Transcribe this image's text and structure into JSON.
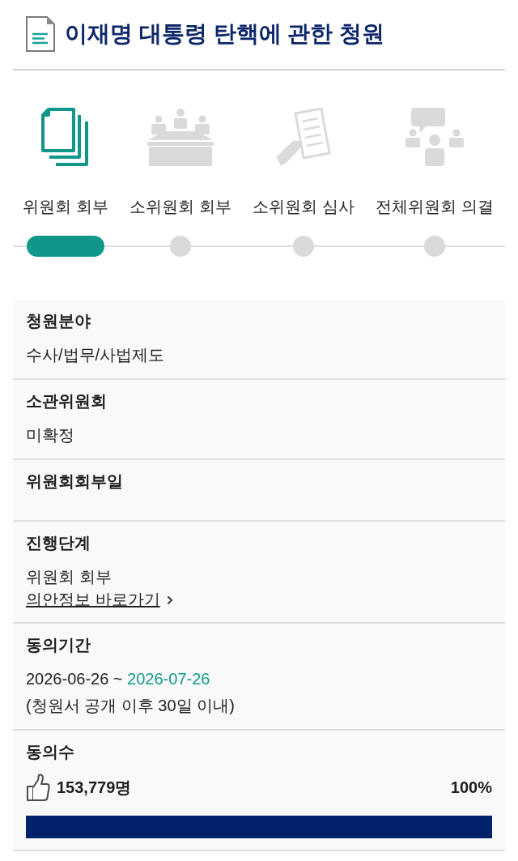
{
  "header": {
    "title": "이재명 대통령 탄핵에 관한 청원"
  },
  "steps": [
    {
      "kind": "referral",
      "label": "위원회 회부",
      "selected": true
    },
    {
      "kind": "subcommittee",
      "label": "소위원회 회부",
      "selected": false
    },
    {
      "kind": "review",
      "label": "소위원회 심사",
      "selected": false
    },
    {
      "kind": "plenary",
      "label": "전체위원회 의결",
      "selected": false
    }
  ],
  "details": [
    {
      "kind": "text",
      "label": "청원분야",
      "value": "수사/법무/사법제도"
    },
    {
      "kind": "text",
      "label": "소관위원회",
      "value": "미확정"
    },
    {
      "kind": "text",
      "label": "위원회회부일"
    },
    {
      "kind": "link",
      "label": "진행단계",
      "value": "위원회 회부",
      "link": "의안정보 바로가기"
    },
    {
      "kind": "period",
      "label": "동의기간",
      "start": "2026-06-26",
      "separator": "~",
      "end": "2026-07-26",
      "note": "(청원서 공개 이후 30일 이내)"
    },
    {
      "kind": "count",
      "label": "동의수",
      "count": "153,779명",
      "percent": "100%",
      "level": 1
    }
  ]
}
